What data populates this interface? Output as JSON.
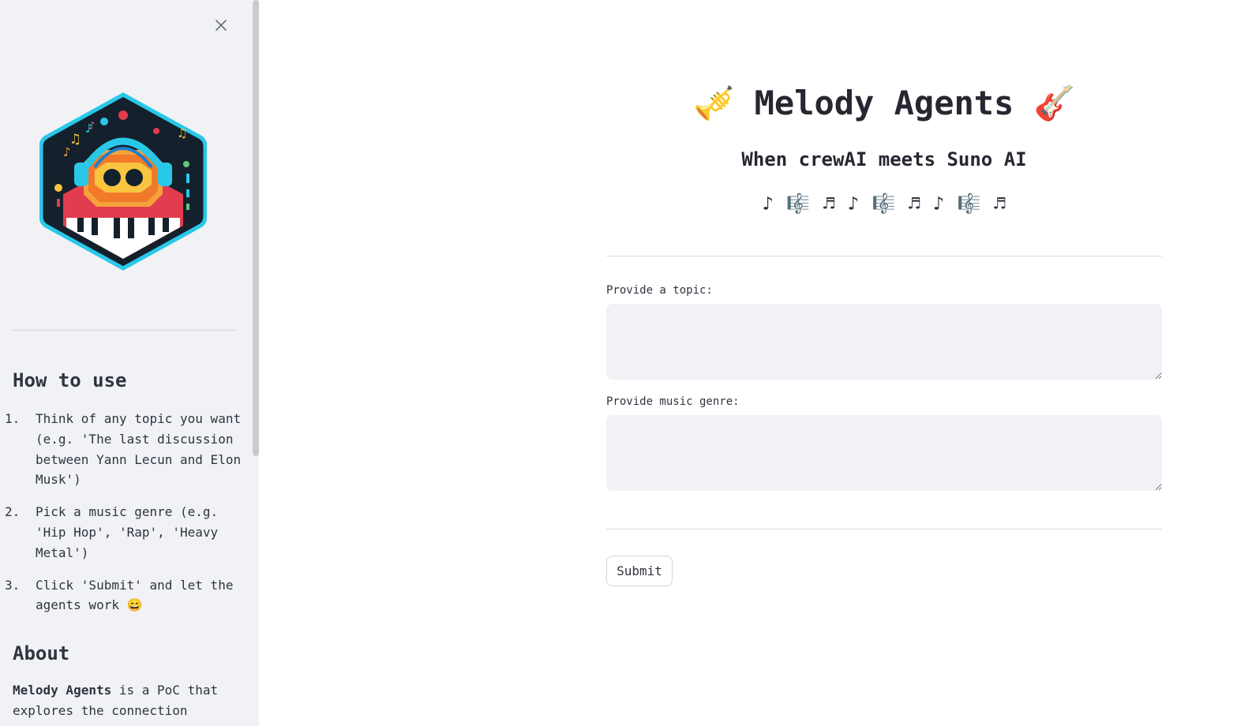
{
  "sidebar": {
    "close_icon": "close-icon",
    "how_to_use_title": "How to use",
    "steps": [
      {
        "num": "1.",
        "text": "Think of any topic you want (e.g. 'The last discussion between Yann Lecun and Elon Musk')"
      },
      {
        "num": "2.",
        "text": "Pick a music genre (e.g. 'Hip Hop', 'Rap', 'Heavy Metal')"
      },
      {
        "num": "3.",
        "text": "Click 'Submit' and let the agents work 😄"
      }
    ],
    "about_title": "About",
    "about_bold": "Melody Agents",
    "about_text": " is a PoC that explores the connection"
  },
  "main": {
    "title": "🎺 Melody Agents 🎸",
    "subtitle": "When crewAI meets Suno AI",
    "notes": "♪ 🎼 ♬ ♪ 🎼 ♬ ♪ 🎼 ♬",
    "topic_label": "Provide a topic:",
    "topic_value": "",
    "genre_label": "Provide music genre:",
    "genre_value": "",
    "submit_label": "Submit"
  },
  "colors": {
    "sidebar_bg": "#f0f2f6",
    "text": "#31333f",
    "input_bg": "#f0f2f6",
    "logo_outline": "#29c8e8",
    "logo_dark": "#14202b"
  }
}
